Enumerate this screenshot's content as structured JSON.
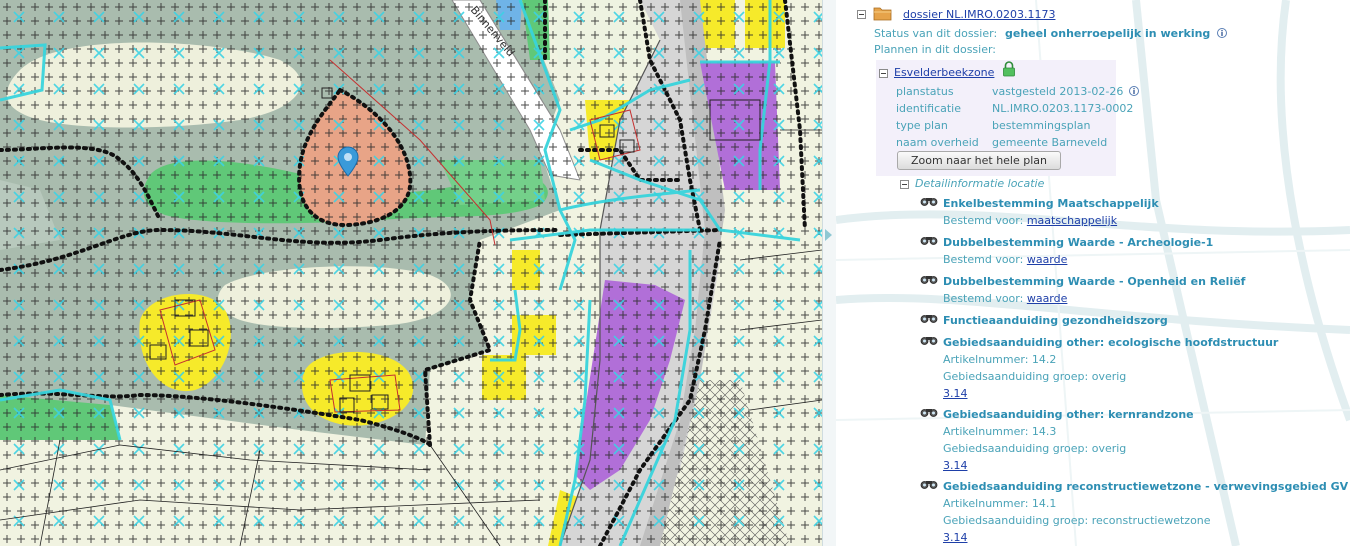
{
  "map": {
    "street_label": "Binnenveld",
    "location_marker": "map-pin-icon"
  },
  "panel": {
    "dossier": {
      "icon": "folder-icon",
      "link": "dossier NL.IMRO.0203.1173",
      "status_label": "Status van dit dossier:",
      "status_value": "geheel onherroepelijk in werking",
      "plans_label": "Plannen in dit dossier:"
    },
    "plan": {
      "name": "Esvelderbeekzone",
      "lock_icon": "lock-icon",
      "fields": [
        {
          "label": "planstatus",
          "value": "vastgesteld 2013-02-26"
        },
        {
          "label": "identificatie",
          "value": "NL.IMRO.0203.1173-0002"
        },
        {
          "label": "type plan",
          "value": "bestemmingsplan"
        },
        {
          "label": "naam overheid",
          "value": "gemeente Barneveld"
        }
      ],
      "zoom_button": "Zoom naar het hele plan"
    },
    "detail": {
      "title": "Detailinformatie locatie",
      "items": [
        {
          "title": "Enkelbestemming Maatschappelijk",
          "sub1": "Bestemd voor: ",
          "link": "maatschappelijk"
        },
        {
          "title": "Dubbelbestemming Waarde - Archeologie-1",
          "sub1": "Bestemd voor: ",
          "link": "waarde"
        },
        {
          "title": "Dubbelbestemming Waarde - Openheid en Reliëf",
          "sub1": "Bestemd voor: ",
          "link": "waarde"
        },
        {
          "title": "Functieaanduiding gezondheidszorg"
        },
        {
          "title": "Gebiedsaanduiding other: ecologische hoofdstructuur",
          "sub1": "Artikelnummer: 14.2",
          "sub2": "Gebiedsaanduiding groep: overig",
          "link": "3.14"
        },
        {
          "title": "Gebiedsaanduiding other: kernrandzone",
          "sub1": "Artikelnummer: 14.3",
          "sub2": "Gebiedsaanduiding groep: overig",
          "link": "3.14"
        },
        {
          "title": "Gebiedsaanduiding reconstructiewetzone - verwevingsgebied GV",
          "sub1": "Artikelnummer: 14.1",
          "sub2": "Gebiedsaanduiding groep: reconstructiewetzone",
          "link": "3.14"
        }
      ]
    }
  },
  "colors": {
    "agrarisch": "#f1f3e1",
    "groen": "#adc8b4",
    "bos": "#60c878",
    "wonen": "#f6ea2a",
    "maatschappelijk": "#e8a487",
    "bedrijf": "#b16fd8",
    "weg": "#cdcdcd",
    "ehs_line": "#38d4dc"
  }
}
